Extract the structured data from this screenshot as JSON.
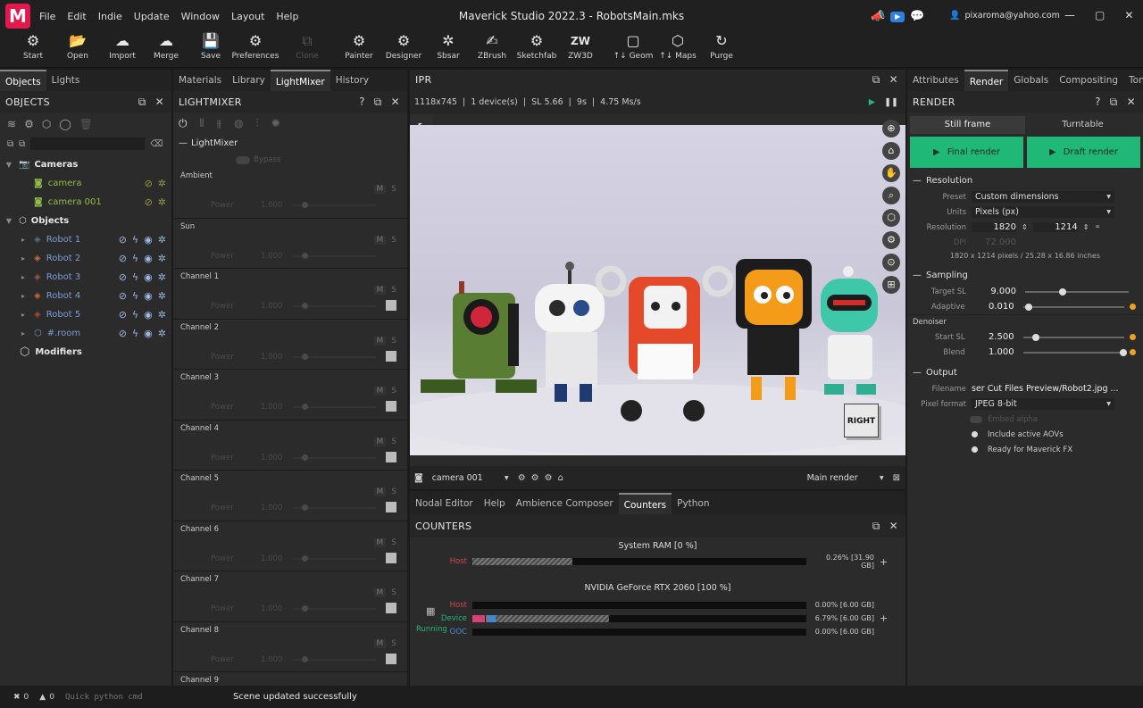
{
  "app": {
    "title": "Maverick Studio 2022.3 - RobotsMain.mks",
    "logo": "M",
    "user": "pixaroma@yahoo.com",
    "accent": "#1fb877",
    "brand": "#e4184c"
  },
  "menu": [
    "File",
    "Edit",
    "Indie",
    "Update",
    "Window",
    "Layout",
    "Help"
  ],
  "toolbar": [
    {
      "label": "Start",
      "icon": "⚙"
    },
    {
      "label": "Open",
      "icon": "📂"
    },
    {
      "label": "Import",
      "icon": "☁"
    },
    {
      "label": "Merge",
      "icon": "☁"
    },
    {
      "label": "Save",
      "icon": "💾"
    },
    {
      "label": "Preferences",
      "icon": "⚙"
    },
    {
      "label": "Clone",
      "icon": "⧉"
    },
    {
      "label": "Painter",
      "icon": "⚙"
    },
    {
      "label": "Designer",
      "icon": "⚙"
    },
    {
      "label": "Sbsar",
      "icon": "✲"
    },
    {
      "label": "ZBrush",
      "icon": "✍"
    },
    {
      "label": "Sketchfab",
      "icon": "⚙"
    },
    {
      "label": "ZW3D",
      "icon": "ZW"
    },
    {
      "label": "↑↓ Geom",
      "icon": "▢"
    },
    {
      "label": "↑↓ Maps",
      "icon": "⬡"
    },
    {
      "label": "Purge",
      "icon": "↻"
    }
  ],
  "left_tabs": [
    "Objects",
    "Lights"
  ],
  "objects_panel": {
    "title": "OBJECTS",
    "cameras_label": "Cameras",
    "cameras": [
      "camera",
      "camera 001"
    ],
    "objects_label": "Objects",
    "objects": [
      "Robot 1",
      "Robot 2",
      "Robot 3",
      "Robot 4",
      "Robot 5",
      "#.room"
    ],
    "modifiers_label": "Modifiers"
  },
  "mid_tabs": [
    "Materials",
    "Library",
    "LightMixer",
    "History"
  ],
  "lightmixer": {
    "title": "LIGHTMIXER",
    "section": "LightMixer",
    "bypass": "Bypass",
    "power_label": "Power",
    "power_value": "1.000",
    "m": "M",
    "s": "S",
    "channels": [
      "Ambient",
      "Sun",
      "Channel 1",
      "Channel 2",
      "Channel 3",
      "Channel 4",
      "Channel 5",
      "Channel 6",
      "Channel 7",
      "Channel 8",
      "Channel 9"
    ]
  },
  "ipr": {
    "title": "IPR",
    "stats": "1118x745  |  1 device(s)  |  SL 5.66  |  9s  |  4.75 Ms/s",
    "camera": "camera 001",
    "render_target": "Main render",
    "cube_label": "RIGHT"
  },
  "bottom_tabs": [
    "Nodal Editor",
    "Help",
    "Ambience Composer",
    "Counters",
    "Python"
  ],
  "counters": {
    "title": "COUNTERS",
    "ram_title": "System RAM  [0 %]",
    "ram_host": "Host",
    "ram_host_value": "0.26% [31.90 GB]",
    "ram_host_fill": 0.3,
    "gpu_title": "NVIDIA GeForce RTX 2060  [100 %]",
    "gpu_host": "Host",
    "gpu_host_value": "0.00% [6.00 GB]",
    "gpu_device": "Device",
    "gpu_device_value": "6.79% [6.00 GB]",
    "gpu_device_fill": 0.41,
    "gpu_ooc": "OOC",
    "gpu_ooc_value": "0.00% [6.00 GB]",
    "status": "Running",
    "plus": "+"
  },
  "right_tabs": [
    "Attributes",
    "Render",
    "Globals",
    "Compositing",
    "Tonemap"
  ],
  "render": {
    "title": "RENDER",
    "still": "Still frame",
    "turntable": "Turntable",
    "final": "Final render",
    "draft": "Draft render",
    "resolution_section": "Resolution",
    "preset_label": "Preset",
    "preset": "Custom dimensions",
    "units_label": "Units",
    "units": "Pixels (px)",
    "res_label": "Resolution",
    "res_w": "1820",
    "res_h": "1214",
    "dpi_label": "DPI",
    "dpi": "72.000",
    "res_info": "1820 x 1214 pixels  /  25.28 x 16.86 inches",
    "sampling_section": "Sampling",
    "target_label": "Target SL",
    "target": "9.000",
    "target_fill": 0.35,
    "adaptive_label": "Adaptive",
    "adaptive": "0.010",
    "adaptive_fill": 0.02,
    "denoiser_label": "Denoiser",
    "start_label": "Start SL",
    "start": "2.500",
    "start_fill": 0.1,
    "blend_label": "Blend",
    "blend": "1.000",
    "blend_fill": 1.0,
    "output_section": "Output",
    "filename_label": "Filename",
    "filename": "ser Cut Files Preview/Robot2.jpg  ...",
    "format_label": "Pixel format",
    "format": "JPEG 8-bit",
    "embed": "Embed alpha",
    "aovs": "Include active AOVs",
    "fx": "Ready for Maverick FX"
  },
  "status": {
    "errors": "0",
    "warnings": "0",
    "python_placeholder": "Quick python cmd",
    "message": "Scene updated successfully"
  }
}
